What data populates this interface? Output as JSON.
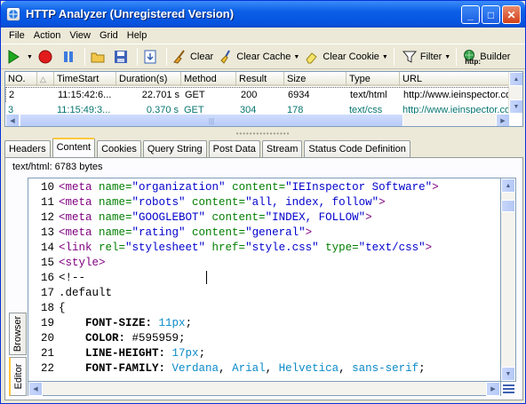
{
  "window": {
    "title": "HTTP Analyzer  (Unregistered Version)",
    "controls": {
      "minimize": "_",
      "maximize": "□",
      "close": "✕"
    }
  },
  "menu": [
    "File",
    "Action",
    "View",
    "Grid",
    "Help"
  ],
  "toolbar": {
    "clear": "Clear",
    "clear_cache": "Clear Cache",
    "clear_cookie": "Clear Cookie",
    "filter": "Filter",
    "builder": "Builder",
    "builder_icon_text": "http:"
  },
  "grid": {
    "columns": [
      "NO.",
      "TimeStart",
      "Duration(s)",
      "Method",
      "Result",
      "Size",
      "Type",
      "URL"
    ],
    "rows": [
      {
        "no": "2",
        "time": "11:15:42:6...",
        "duration": "22.701 s",
        "method": "GET",
        "result": "200",
        "size": "6934",
        "type": "text/html",
        "url": "http://www.ieinspector.co"
      },
      {
        "no": "3",
        "time": "11:15:49:3...",
        "duration": "0.370 s",
        "method": "GET",
        "result": "304",
        "size": "178",
        "type": "text/css",
        "url": "http://www.ieinspector.co"
      }
    ]
  },
  "tabs": [
    "Headers",
    "Content",
    "Cookies",
    "Query String",
    "Post Data",
    "Stream",
    "Status Code Definition"
  ],
  "active_tab": "Content",
  "info": "text/html: 6783 bytes",
  "side_tabs": {
    "browser": "Browser",
    "editor": "Editor"
  },
  "code": [
    {
      "n": "10",
      "parts": [
        [
          "tag",
          "<meta "
        ],
        [
          "attr",
          "name="
        ],
        [
          "str",
          "\"organization\""
        ],
        [
          "attr",
          " content="
        ],
        [
          "str",
          "\"IEInspector Software\""
        ],
        [
          "tag",
          ">"
        ]
      ]
    },
    {
      "n": "11",
      "parts": [
        [
          "tag",
          "<meta "
        ],
        [
          "attr",
          "name="
        ],
        [
          "str",
          "\"robots\""
        ],
        [
          "attr",
          " content="
        ],
        [
          "str",
          "\"all, index, follow\""
        ],
        [
          "tag",
          ">"
        ]
      ]
    },
    {
      "n": "12",
      "parts": [
        [
          "tag",
          "<meta "
        ],
        [
          "attr",
          "name="
        ],
        [
          "str",
          "\"GOOGLEBOT\""
        ],
        [
          "attr",
          " content="
        ],
        [
          "str",
          "\"INDEX, FOLLOW\""
        ],
        [
          "tag",
          ">"
        ]
      ]
    },
    {
      "n": "13",
      "parts": [
        [
          "tag",
          "<meta "
        ],
        [
          "attr",
          "name="
        ],
        [
          "str",
          "\"rating\""
        ],
        [
          "attr",
          " content="
        ],
        [
          "str",
          "\"general\""
        ],
        [
          "tag",
          ">"
        ]
      ]
    },
    {
      "n": "14",
      "parts": [
        [
          "tag",
          "<link "
        ],
        [
          "attr",
          "rel="
        ],
        [
          "str",
          "\"stylesheet\""
        ],
        [
          "attr",
          " href="
        ],
        [
          "str",
          "\"style.css\""
        ],
        [
          "attr",
          " type="
        ],
        [
          "str",
          "\"text/css\""
        ],
        [
          "tag",
          ">"
        ]
      ]
    },
    {
      "n": "15",
      "parts": [
        [
          "tag",
          "<style>"
        ]
      ]
    },
    {
      "n": "16",
      "parts": [
        [
          "plain",
          "<!--"
        ]
      ]
    },
    {
      "n": "17",
      "parts": [
        [
          "plain",
          ".default"
        ]
      ]
    },
    {
      "n": "18",
      "parts": [
        [
          "plain",
          "{"
        ]
      ]
    },
    {
      "n": "19",
      "parts": [
        [
          "kw",
          "    FONT-SIZE: "
        ],
        [
          "num",
          "11"
        ],
        [
          "unit",
          "px"
        ],
        [
          "plain",
          ";"
        ]
      ]
    },
    {
      "n": "20",
      "parts": [
        [
          "kw",
          "    COLOR: "
        ],
        [
          "plain",
          "#595959;"
        ]
      ]
    },
    {
      "n": "21",
      "parts": [
        [
          "kw",
          "    LINE-HEIGHT: "
        ],
        [
          "num",
          "17"
        ],
        [
          "unit",
          "px"
        ],
        [
          "plain",
          ";"
        ]
      ]
    },
    {
      "n": "22",
      "parts": [
        [
          "kw",
          "    FONT-FAMILY: "
        ],
        [
          "fn",
          "Verdana"
        ],
        [
          "plain",
          ", "
        ],
        [
          "fn",
          "Arial"
        ],
        [
          "plain",
          ", "
        ],
        [
          "fn",
          "Helvetica"
        ],
        [
          "plain",
          ", "
        ],
        [
          "fn",
          "sans-serif"
        ],
        [
          "plain",
          ";"
        ]
      ]
    }
  ],
  "colors": {
    "title_bar": "#0A5FE6",
    "accent_tab": "#FFC83C",
    "row_text_2": "#07756F",
    "tag": "#800080",
    "attr": "#007F00",
    "string": "#0000CC"
  }
}
